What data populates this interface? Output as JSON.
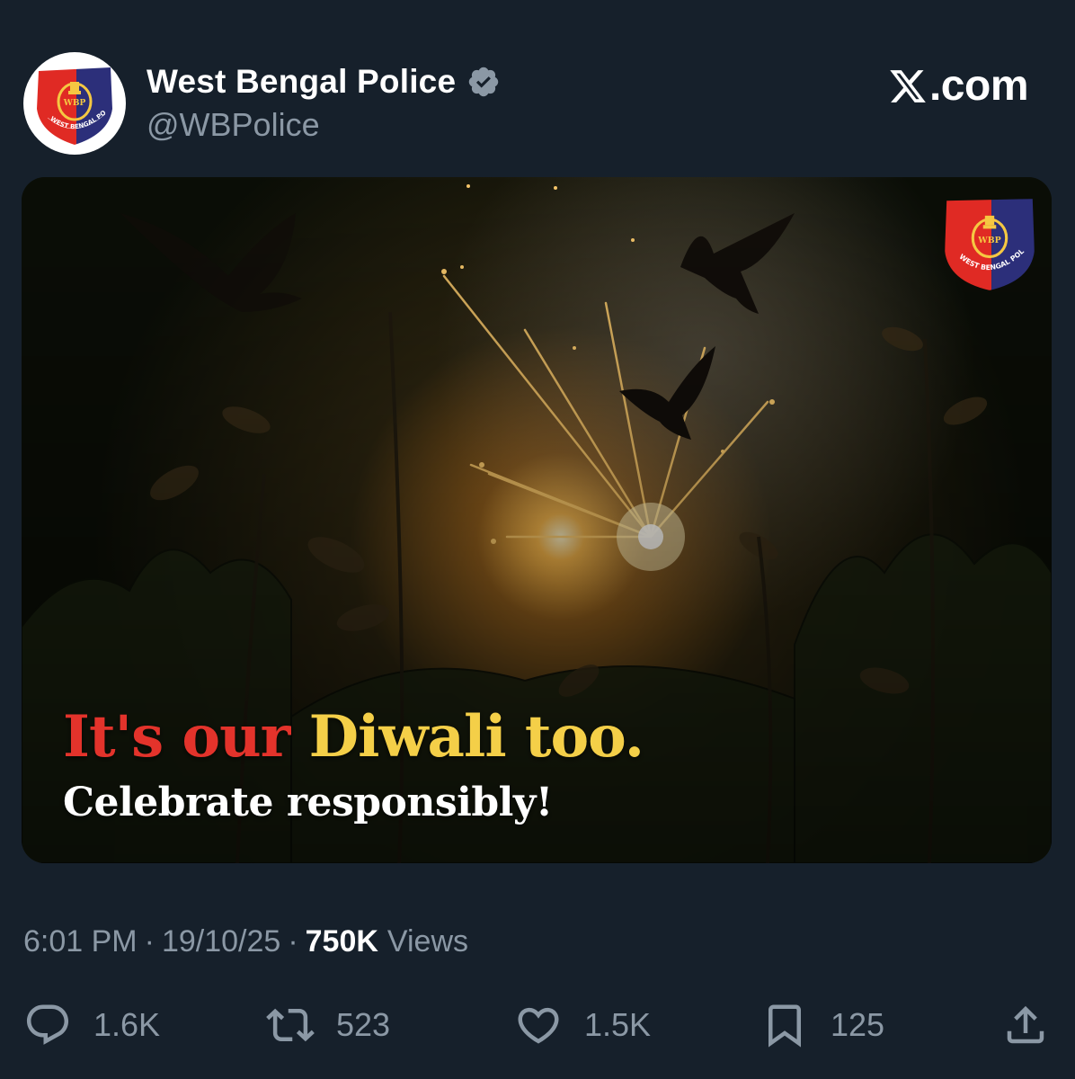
{
  "author": {
    "display_name": "West Bengal Police",
    "handle": "@WBPolice",
    "verified": true,
    "avatar_icon": "west-bengal-police-emblem",
    "emblem_text": "WEST BENGAL POLICE"
  },
  "brand": {
    "site_label": ".com",
    "logo_icon": "x-logo"
  },
  "media": {
    "headline_part1": "It's our ",
    "headline_part2": "Diwali too.",
    "subline": "Celebrate responsibly!",
    "badge_icon": "west-bengal-police-emblem",
    "colors": {
      "headline_red": "#e3332b",
      "headline_yellow": "#f4cf48"
    }
  },
  "meta": {
    "time": "6:01 PM",
    "date": "19/10/25",
    "views_count": "750K",
    "views_label": "Views",
    "separator": "·"
  },
  "actions": {
    "reply": {
      "icon": "reply-icon",
      "count": "1.6K"
    },
    "retweet": {
      "icon": "retweet-icon",
      "count": "523"
    },
    "like": {
      "icon": "heart-icon",
      "count": "1.5K"
    },
    "bookmark": {
      "icon": "bookmark-icon",
      "count": "125"
    },
    "share": {
      "icon": "share-icon"
    }
  },
  "theme": {
    "background": "#16202b",
    "secondary_text": "#8b98a5",
    "verified_badge": "#8b98a5"
  }
}
